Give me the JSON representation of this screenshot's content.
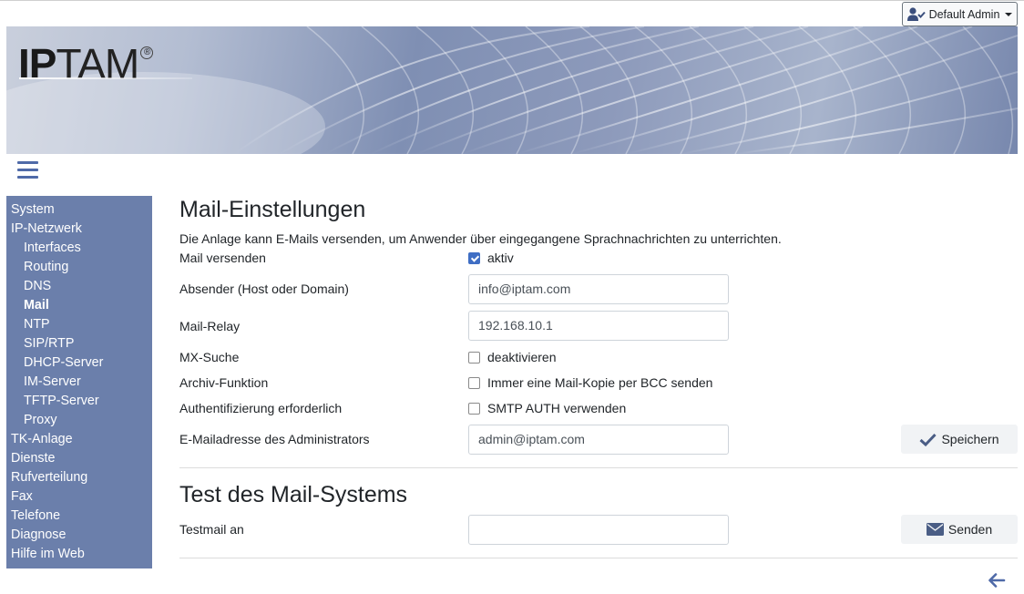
{
  "header": {
    "user_label": "Default Admin",
    "logo_ip": "IP",
    "logo_tam": "TAM",
    "logo_reg": "®"
  },
  "sidebar": {
    "items": [
      {
        "label": "System",
        "level": 0
      },
      {
        "label": "IP-Netzwerk",
        "level": 0
      },
      {
        "label": "Interfaces",
        "level": 1
      },
      {
        "label": "Routing",
        "level": 1
      },
      {
        "label": "DNS",
        "level": 1
      },
      {
        "label": "Mail",
        "level": 1,
        "active": true
      },
      {
        "label": "NTP",
        "level": 1
      },
      {
        "label": "SIP/RTP",
        "level": 1
      },
      {
        "label": "DHCP-Server",
        "level": 1
      },
      {
        "label": "IM-Server",
        "level": 1
      },
      {
        "label": "TFTP-Server",
        "level": 1
      },
      {
        "label": "Proxy",
        "level": 1
      },
      {
        "label": "TK-Anlage",
        "level": 0
      },
      {
        "label": "Dienste",
        "level": 0
      },
      {
        "label": "Rufverteilung",
        "level": 0
      },
      {
        "label": "Fax",
        "level": 0
      },
      {
        "label": "Telefone",
        "level": 0
      },
      {
        "label": "Diagnose",
        "level": 0
      },
      {
        "label": "Hilfe im Web",
        "level": 0
      }
    ]
  },
  "mail": {
    "title": "Mail-Einstellungen",
    "description": "Die Anlage kann E-Mails versenden, um Anwender über eingegangene Sprachnachrichten zu unterrichten.",
    "send_label": "Mail versenden",
    "send_check": "aktiv",
    "send_checked": true,
    "sender_label": "Absender (Host oder Domain)",
    "sender_value": "info@iptam.com",
    "relay_label": "Mail-Relay",
    "relay_value": "192.168.10.1",
    "mx_label": "MX-Suche",
    "mx_check": "deaktivieren",
    "mx_checked": false,
    "archive_label": "Archiv-Funktion",
    "archive_check": "Immer eine Mail-Kopie per BCC senden",
    "archive_checked": false,
    "auth_label": "Authentifizierung erforderlich",
    "auth_check": "SMTP AUTH verwenden",
    "auth_checked": false,
    "admin_label": "E-Mailadresse des Administrators",
    "admin_value": "admin@iptam.com",
    "save_label": "Speichern"
  },
  "test": {
    "title": "Test des Mail-Systems",
    "testmail_label": "Testmail an",
    "testmail_value": "",
    "send_label": "Senden"
  },
  "colors": {
    "sidebar_bg": "#6b7fab",
    "accent": "#4f6aa8",
    "checkbox": "#3f6ec4"
  }
}
